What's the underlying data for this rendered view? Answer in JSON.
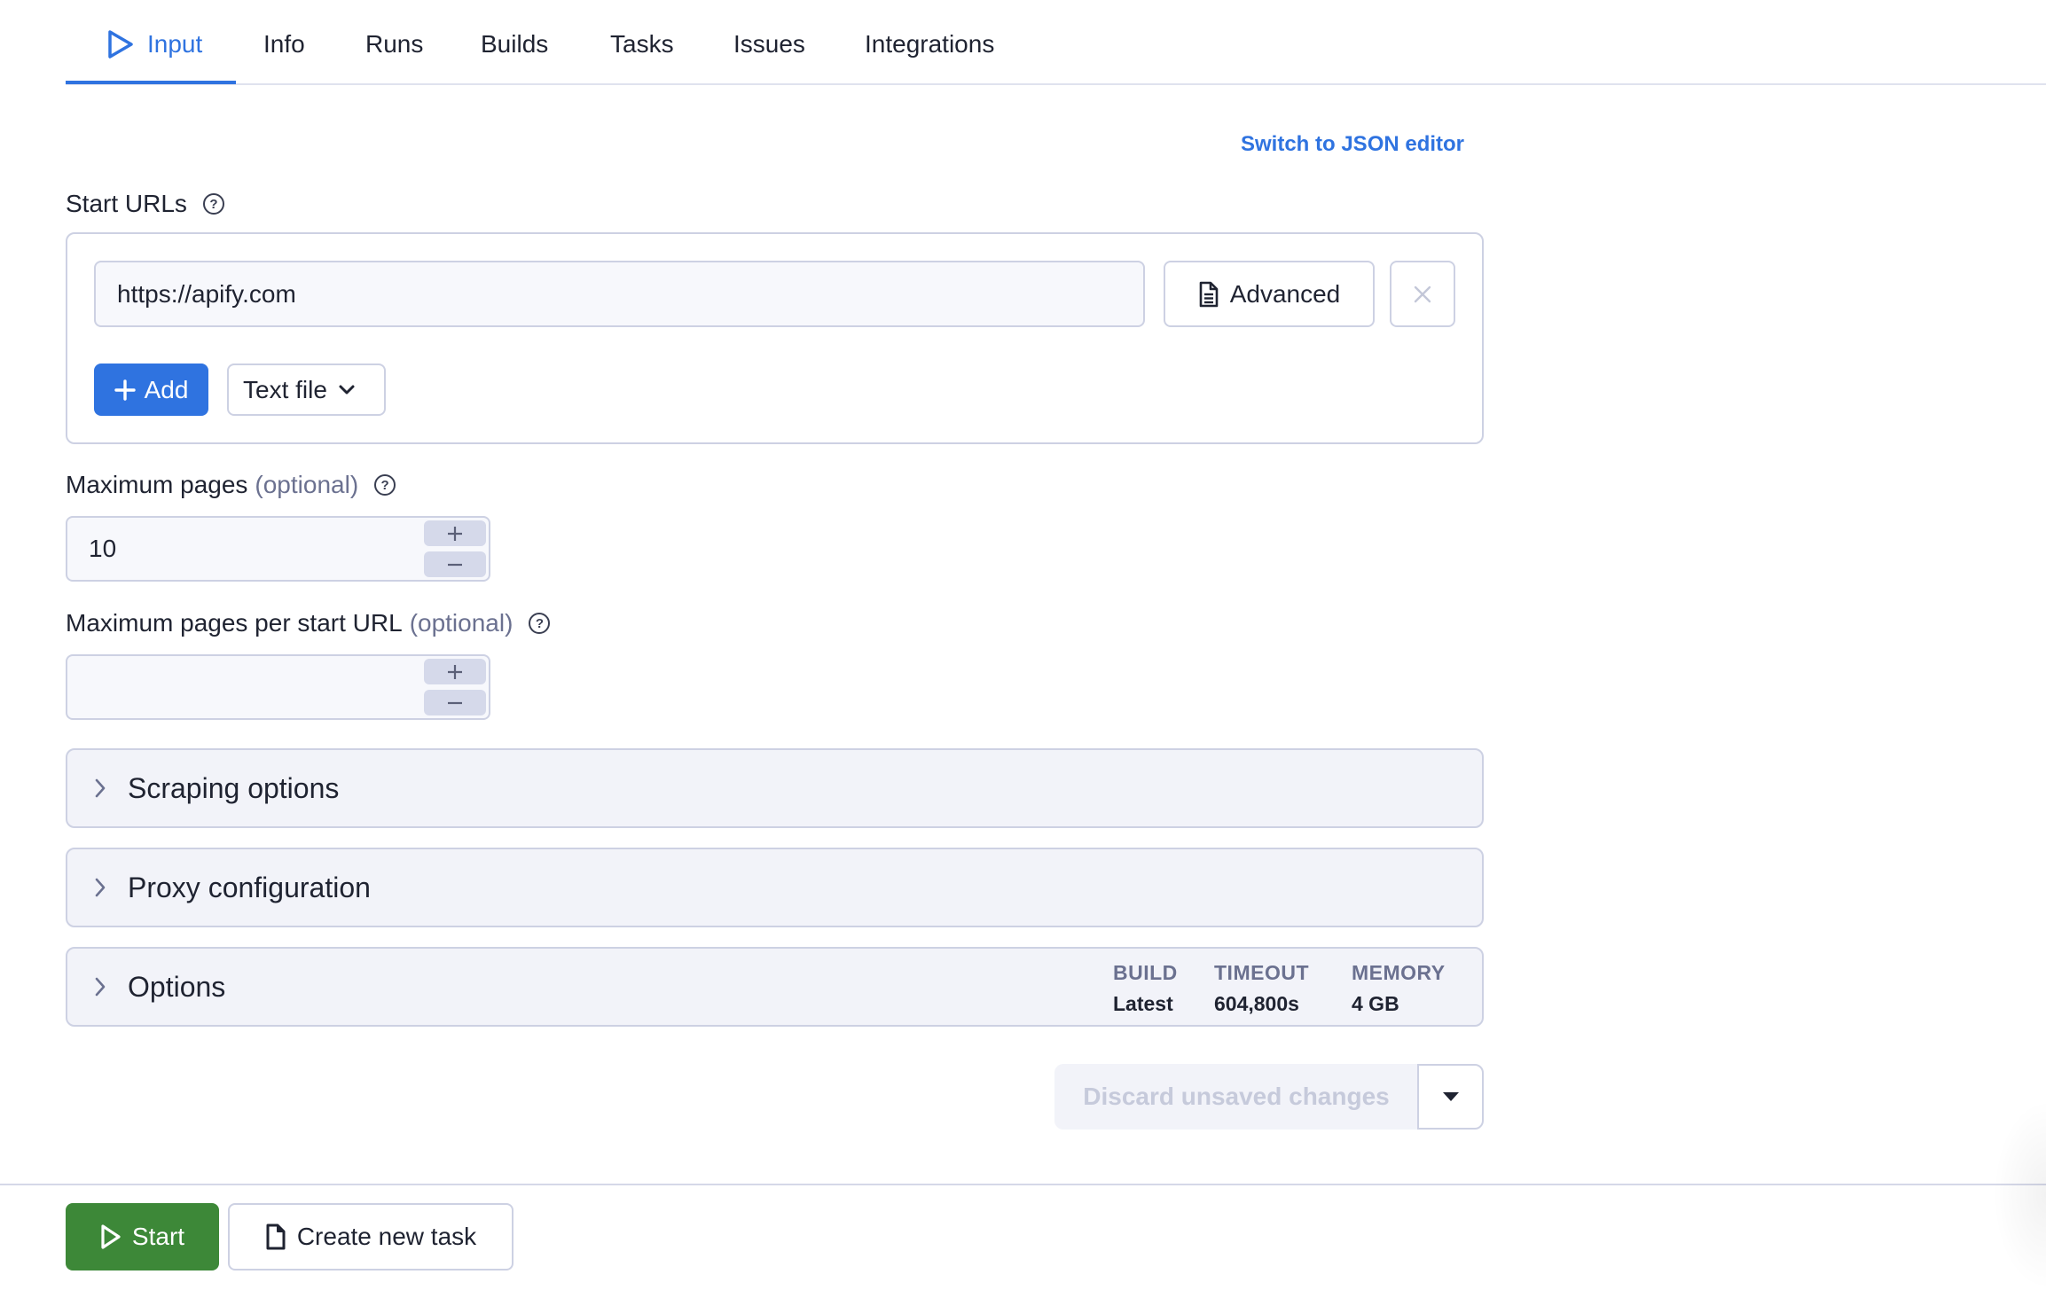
{
  "tabs": [
    {
      "label": "Input",
      "icon": "play-icon",
      "active": true
    },
    {
      "label": "Info"
    },
    {
      "label": "Runs"
    },
    {
      "label": "Builds"
    },
    {
      "label": "Tasks"
    },
    {
      "label": "Issues"
    },
    {
      "label": "Integrations"
    }
  ],
  "editor_switch_label": "Switch to JSON editor",
  "start_urls": {
    "label": "Start URLs",
    "help_icon": "help-circle-icon",
    "urls": [
      "https://apify.com"
    ],
    "advanced_label": "Advanced",
    "advanced_icon": "document-icon",
    "remove_icon": "close-icon",
    "add_label": "Add",
    "add_icon": "plus-icon",
    "source_select": "Text file"
  },
  "max_pages": {
    "label": "Maximum pages",
    "optional": "(optional)",
    "value": "10"
  },
  "max_pages_per_url": {
    "label": "Maximum pages per start URL",
    "optional": "(optional)",
    "value": ""
  },
  "sections": [
    {
      "title": "Scraping options"
    },
    {
      "title": "Proxy configuration"
    },
    {
      "title": "Options"
    }
  ],
  "run_options": {
    "build_label": "BUILD",
    "build_value": "Latest",
    "timeout_label": "TIMEOUT",
    "timeout_value": "604,800s",
    "memory_label": "MEMORY",
    "memory_value": "4 GB"
  },
  "discard_label": "Discard unsaved changes",
  "footer": {
    "start_label": "Start",
    "create_task_label": "Create new task"
  },
  "colors": {
    "accent": "#2f73e0",
    "start_green": "#3d8838",
    "border": "#cdd1e3",
    "panel_bg": "#f2f3f9"
  }
}
